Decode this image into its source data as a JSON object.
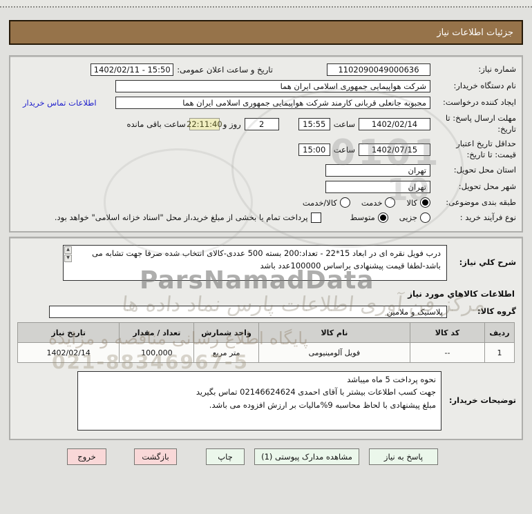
{
  "title_bar": {
    "title": "جزئیات اطلاعات نیاز"
  },
  "panel1": {
    "need_number": {
      "label": "شماره نیاز:",
      "value": "1102090049000636"
    },
    "announce": {
      "label": "تاریخ و ساعت اعلان عمومی:",
      "value": "1402/02/11 - 15:50"
    },
    "buyer_org": {
      "label": "نام دستگاه خریدار:",
      "value": "شرکت هواپیمایی جمهوری اسلامی ایران هما"
    },
    "requester": {
      "label": "ایجاد کننده درخواست:",
      "value": "محبوبه جانعلی قربانی کارمند شرکت هواپیمایی جمهوری اسلامی ایران هما",
      "contact_link": "اطلاعات تماس خریدار"
    },
    "deadline": {
      "label": "مهلت ارسال پاسخ: تا تاریخ:",
      "date": "1402/02/14",
      "hour_label": "ساعت",
      "time": "15:55",
      "days": "2",
      "days_label": "روز و",
      "remaining": "22:11:40",
      "remaining_label": "ساعت باقی مانده"
    },
    "validity": {
      "label": "حداقل تاریخ اعتبار قیمت: تا تاریخ:",
      "date": "1402/07/15",
      "hour_label": "ساعت",
      "time": "15:00"
    },
    "province": {
      "label": "استان محل تحویل:",
      "value": "تهران"
    },
    "city": {
      "label": "شهر محل تحویل:",
      "value": "تهران"
    },
    "category": {
      "label": "طبقه بندی موضوعی:",
      "options": [
        {
          "label": "کالا",
          "selected": true
        },
        {
          "label": "خدمت",
          "selected": false
        },
        {
          "label": "کالا/خدمت",
          "selected": false
        }
      ]
    },
    "process": {
      "label": "نوع فرآیند خرید :",
      "options": [
        {
          "label": "جزیی",
          "selected": false
        },
        {
          "label": "متوسط",
          "selected": true
        }
      ],
      "treasury_note": "پرداخت تمام یا بخشی از مبلغ خرید،از محل \"اسناد خزانه اسلامی\" خواهد بود."
    }
  },
  "panel2": {
    "need_desc": {
      "label": "شرح کلي نیاز:",
      "value": "درب فویل نقره ای در ابعاد 15*22 - تعداد:200 بسته 500 عددی-کالای انتخاب شده صرفا جهت تشابه می باشد-لطفا قیمت پیشنهادی براساس 100000عدد باشد"
    },
    "goods_header": "اطلاعات کالاهاي مورد نیاز",
    "goods_group": {
      "label": "گروه کالا:",
      "value": "پلاستیک و ملامین"
    },
    "table": {
      "headers": [
        "ردیف",
        "کد کالا",
        "نام کالا",
        "واحد شمارش",
        "تعداد / مقدار",
        "تاریخ نیاز"
      ],
      "rows": [
        [
          "1",
          "--",
          "فویل آلومینیومی",
          "متر مربع",
          "100,000",
          "1402/02/14"
        ]
      ]
    },
    "buyer_notes": {
      "label": "توضیحات خریدار:",
      "lines": [
        "نحوه پرداخت 5 ماه میباشد",
        "جهت کسب اطلاعات بیشتر با آقای احمدی 02146624624 تماس بگیرید",
        "مبلغ پیشنهادی با لحاظ محاسبه 9%مالیات بر ارزش افزوده می باشد."
      ]
    }
  },
  "buttons": {
    "respond": "پاسخ به نیاز",
    "view_attachments": "مشاهده مدارک پیوستی (1)",
    "print": "چاپ",
    "back": "بازگشت",
    "exit": "خروج"
  },
  "watermarks": {
    "brand": "ParsNamadData",
    "line1": "مرکز فن آوری اطلاعات پارس نماد داده ها",
    "line2": "پایگاه اطلاع رسانی مناقصه و مزایده",
    "phone": "021-88346967-5",
    "digits1": "0101",
    "digits2": "10"
  },
  "colors": {
    "title_bar": "#96734a",
    "panel_bg": "#ebebe8",
    "highlight_box": "#f0eec0",
    "link": "#1d1dcc",
    "button_green": "#ebf7eb",
    "button_pink": "#f9d8d8",
    "table_header_bg": "#d2d2cf"
  }
}
